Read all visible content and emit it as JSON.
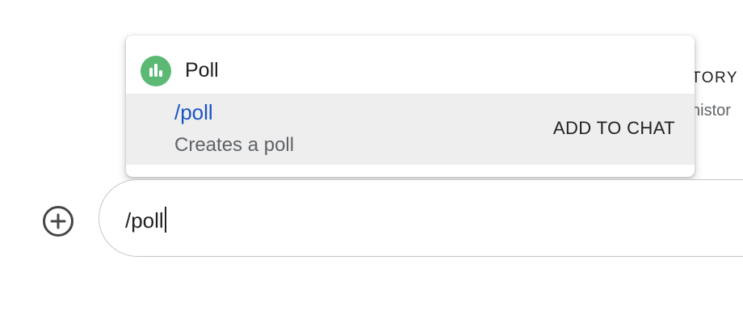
{
  "background": {
    "history_title_fragment": "TORY",
    "history_subtitle_fragment": "histor"
  },
  "autocomplete": {
    "app": {
      "name": "Poll",
      "icon": "poll-bar-chart-icon",
      "icon_color": "#5bb974"
    },
    "command": {
      "name": "/poll",
      "description": "Creates a poll",
      "action_label": "ADD TO CHAT"
    }
  },
  "composer": {
    "add_icon": "add-circle-icon",
    "text": "/poll"
  },
  "colors": {
    "command_link": "#1a54c4",
    "selected_row_bg": "#eeeeee",
    "icon_gray": "#444746"
  }
}
